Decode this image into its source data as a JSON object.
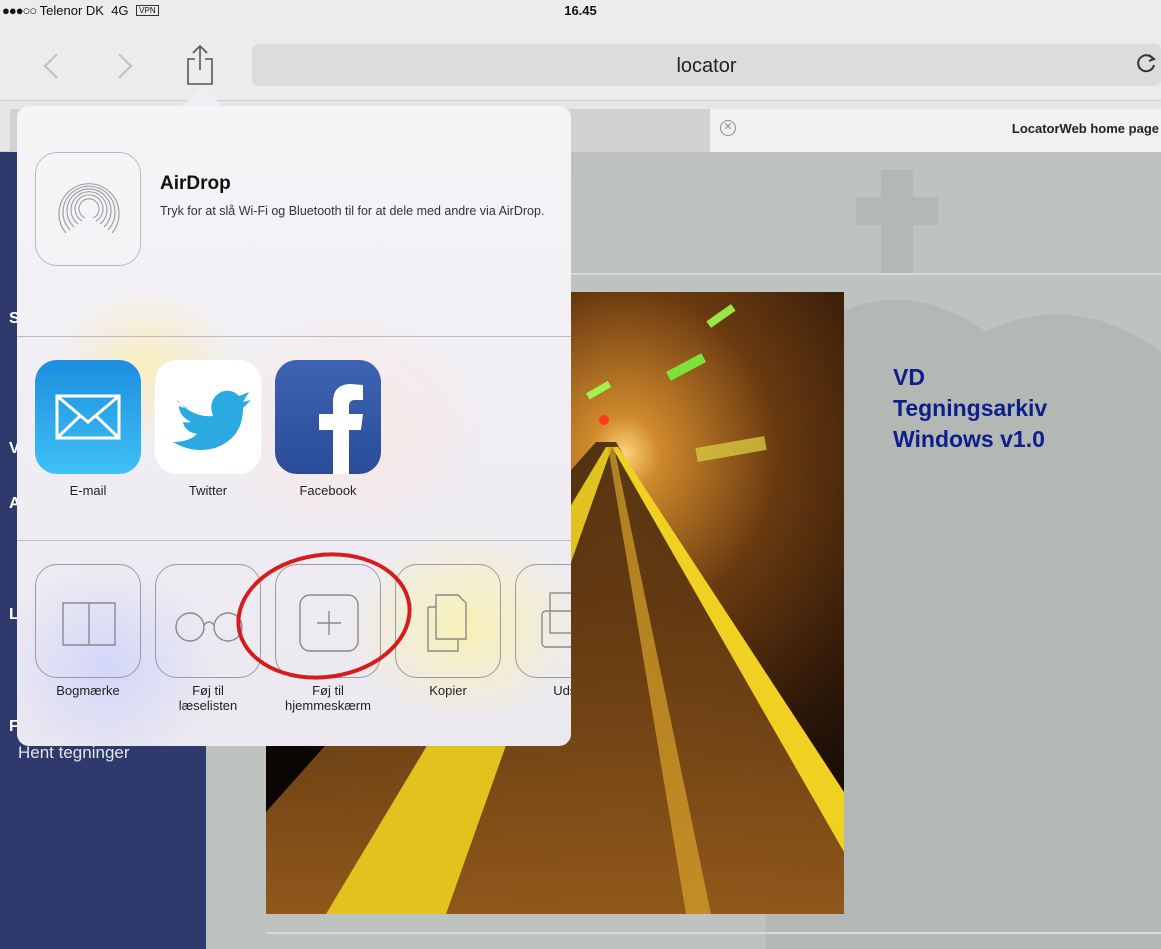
{
  "status_bar": {
    "signal": "●●●○○",
    "carrier": "Telenor DK",
    "network": "4G",
    "vpn": "VPN",
    "time": "16.45"
  },
  "toolbar": {
    "back_icon": "chevron-left",
    "forward_icon": "chevron-right",
    "share_icon": "share",
    "url": "locator",
    "reload_icon": "reload"
  },
  "tabs": [
    {
      "label": "",
      "active": false
    },
    {
      "label": "LocatorWeb home page",
      "active": true
    }
  ],
  "page": {
    "sidebar_letters": [
      "S",
      "V",
      "A",
      "L",
      "F"
    ],
    "sidebar_link": "Hent tegninger",
    "title_lines": [
      "VD",
      "Tegningsarkiv",
      "Windows v1.0"
    ]
  },
  "share_sheet": {
    "airdrop": {
      "title": "AirDrop",
      "description": "Tryk for at slå Wi-Fi og Bluetooth til for at dele med andre via AirDrop."
    },
    "apps": [
      {
        "label": "E-mail",
        "icon": "mail-icon"
      },
      {
        "label": "Twitter",
        "icon": "twitter-icon"
      },
      {
        "label": "Facebook",
        "icon": "facebook-icon"
      }
    ],
    "actions": [
      {
        "label": "Bogmærke",
        "icon": "book-icon"
      },
      {
        "label": "Føj til\nlæselisten",
        "icon": "glasses-icon"
      },
      {
        "label": "Føj til\nhjemmeskærm",
        "icon": "add-square-icon"
      },
      {
        "label": "Kopier",
        "icon": "copy-icon"
      },
      {
        "label": "Udsk",
        "icon": "print-icon"
      }
    ]
  },
  "colors": {
    "sidebar": "#2e3a6b",
    "title": "#0d1f8c",
    "highlight": "#d61d1d",
    "content_bg": "#bfc3c0"
  }
}
